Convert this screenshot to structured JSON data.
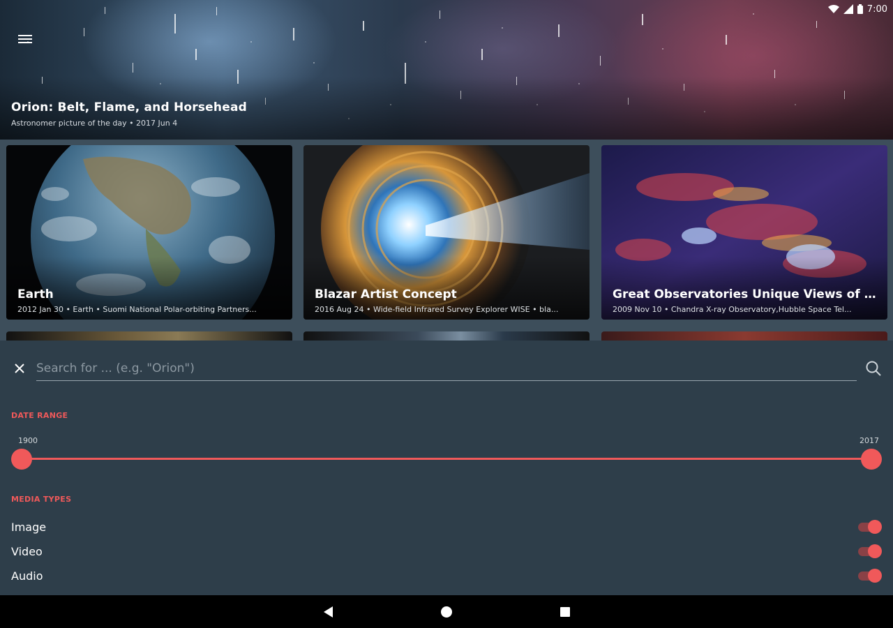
{
  "status": {
    "time": "7:00"
  },
  "hero": {
    "title": "Orion: Belt, Flame, and Horsehead",
    "subtitle": "Astronomer picture of the day • 2017 Jun 4"
  },
  "cards": [
    {
      "title": "Earth",
      "meta": "2012 Jan 30 • Earth • Suomi National Polar-orbiting Partners..."
    },
    {
      "title": "Blazar Artist Concept",
      "meta": "2016 Aug 24 • Wide-field Infrared Survey Explorer WISE • bla..."
    },
    {
      "title": "Great Observatories Unique Views of the Mi...",
      "meta": "2009 Nov 10 • Chandra X-ray Observatory,Hubble Space Tel..."
    }
  ],
  "search": {
    "placeholder": "Search for ... (e.g. \"Orion\")"
  },
  "filters": {
    "date_range_label": "DATE RANGE",
    "range_min": "1900",
    "range_max": "2017",
    "media_types_label": "MEDIA TYPES",
    "media": [
      {
        "label": "Image",
        "enabled": true
      },
      {
        "label": "Video",
        "enabled": true
      },
      {
        "label": "Audio",
        "enabled": true
      }
    ]
  },
  "colors": {
    "accent": "#f0595a",
    "panel": "#2e3e4a",
    "grid_bg": "#3d4e5b"
  }
}
